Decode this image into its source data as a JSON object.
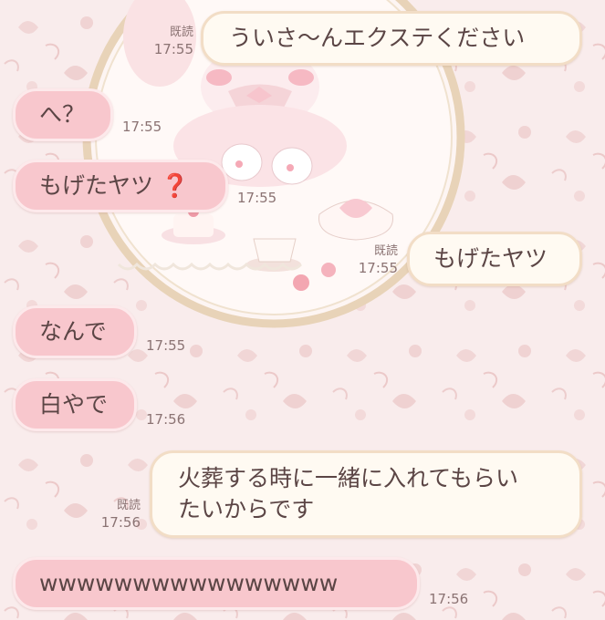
{
  "messages": [
    {
      "side": "out",
      "text": "ういさ〜んエクステください",
      "read": "既読",
      "time": "17:55"
    },
    {
      "side": "in",
      "text": "へ？",
      "time": "17:55"
    },
    {
      "side": "in",
      "text": "もげたヤツ",
      "emoji": "❓",
      "time": "17:55"
    },
    {
      "side": "out",
      "text": "もげたヤツ",
      "read": "既読",
      "time": "17:55"
    },
    {
      "side": "in",
      "text": "なんで",
      "time": "17:55"
    },
    {
      "side": "in",
      "text": "白やで",
      "time": "17:56"
    },
    {
      "side": "out",
      "text": "火葬する時に一緒に入れてもらい",
      "text2": "たいからです",
      "read": "既読",
      "time": "17:56"
    },
    {
      "side": "in",
      "text": "wwwwwwwwwwwwwwww",
      "time": "17:56"
    }
  ],
  "colors": {
    "incoming_bubble": "#f8c7cd",
    "outgoing_bubble": "#fffaf2",
    "background": "#f9ecec",
    "text": "#5b4545",
    "question_mark": "#d81d2b"
  },
  "icons": [
    "red-question-mark-icon"
  ]
}
